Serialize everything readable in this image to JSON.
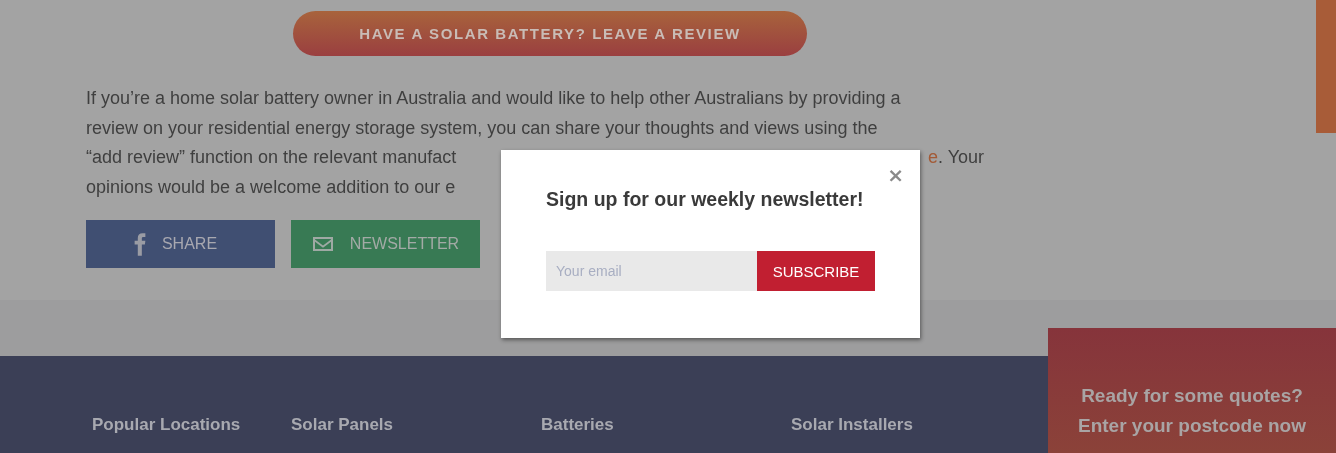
{
  "review_button": {
    "label": "HAVE A SOLAR BATTERY? LEAVE A REVIEW"
  },
  "paragraph_lines": [
    {
      "left": "If you’re a home solar battery owner in Australia and would like to help other Australians by providing a"
    },
    {
      "left": "review on your residential energy storage system, you can share your thoughts and views using the"
    },
    {
      "left": "“add review” function on the relevant manufact",
      "link": "e",
      "right": ". Your"
    },
    {
      "left": "opinions would be a welcome addition to our e"
    }
  ],
  "share_buttons": [
    {
      "kind": "facebook",
      "label": "SHARE"
    },
    {
      "kind": "newsletter",
      "label": "NEWSLETTER"
    }
  ],
  "footer_headings": [
    "Popular Locations",
    "Solar Panels",
    "Batteries",
    "Solar Installers"
  ],
  "quote_box": {
    "lines": [
      "Ready for some quotes?",
      "Enter your postcode now"
    ]
  },
  "popup": {
    "close": "×",
    "title": "Sign up for our weekly newsletter!",
    "email": {
      "placeholder": "Your email"
    },
    "button": "SUBSCRIBE"
  }
}
